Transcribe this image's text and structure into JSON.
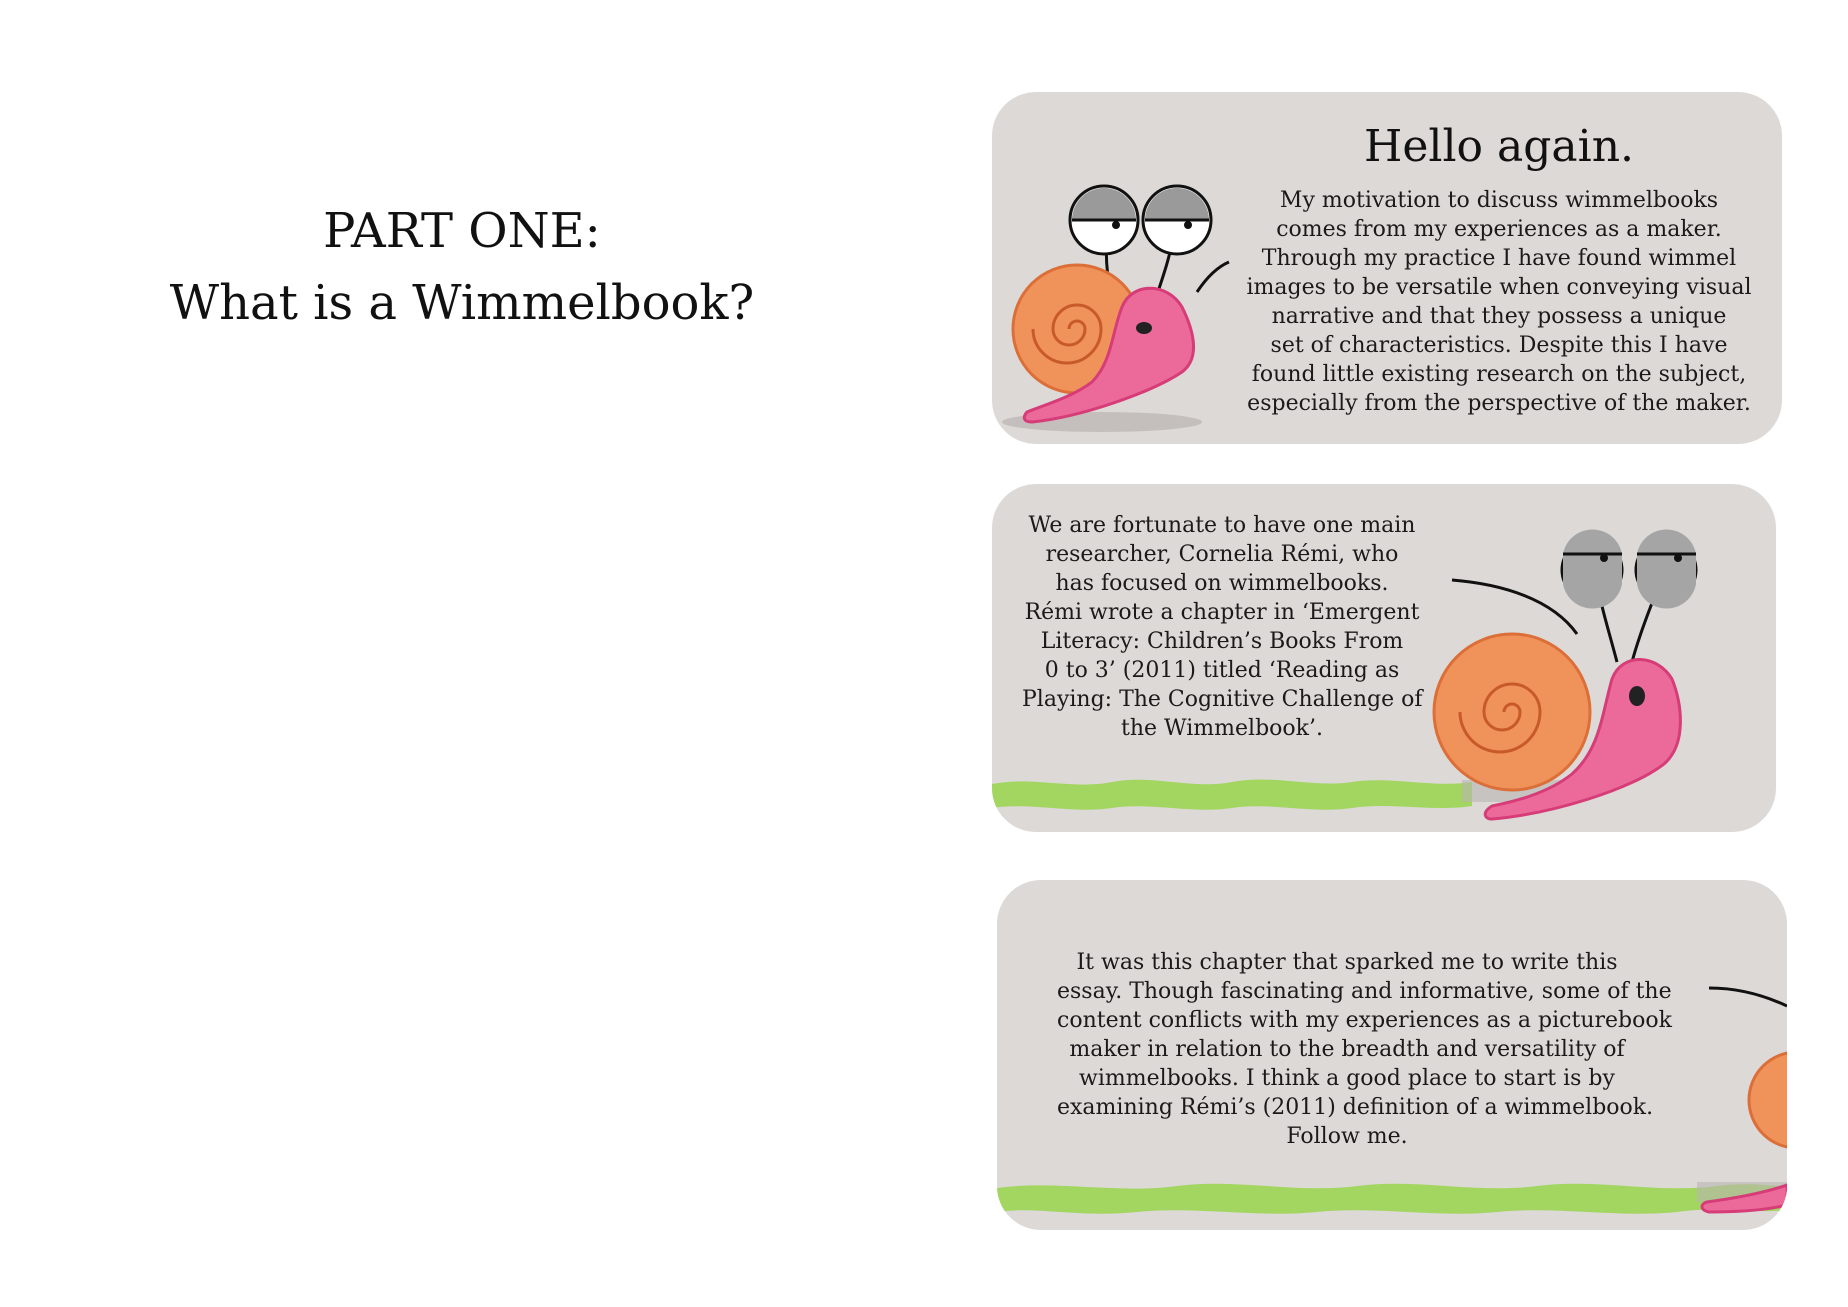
{
  "left_page": {
    "heading_lines": [
      "PART ONE:",
      "What is a Wimmelbook?"
    ]
  },
  "panels": [
    {
      "title": "Hello again.",
      "lines": [
        "My motivation to discuss wimmelbooks",
        "comes from my experiences as a maker.",
        "Through my practice I have found wimmel",
        "images to be versatile when conveying visual",
        "narrative and that they possess a unique",
        "set of characteristics. Despite this I have",
        "found little existing research on the subject,",
        "especially from the perspective of the maker."
      ]
    },
    {
      "lines": [
        "We are fortunate to have one main",
        "researcher, Cornelia Rémi, who",
        "has focused on wimmelbooks.",
        "Rémi wrote a chapter in ‘Emergent",
        "Literacy: Children’s Books From",
        "0 to 3’ (2011) titled  ‘Reading as",
        "Playing: The Cognitive Challenge of",
        "the Wimmelbook’."
      ]
    },
    {
      "lines": [
        "It was this chapter that sparked me to write this",
        "essay. Though fascinating and informative, some of the",
        "content conflicts with my experiences as a picturebook",
        "maker in relation to the breadth and versatility of",
        "wimmelbooks. I think a good place to start is by",
        "examining Rémi’s (2011) definition of a wimmelbook.",
        "Follow me."
      ]
    }
  ],
  "illustration": {
    "character": "snail",
    "colors": {
      "panel_bg": "#ddd9d6",
      "shell": "#f0935a",
      "body": "#ec6a9a",
      "grass": "#9ed65a"
    }
  }
}
